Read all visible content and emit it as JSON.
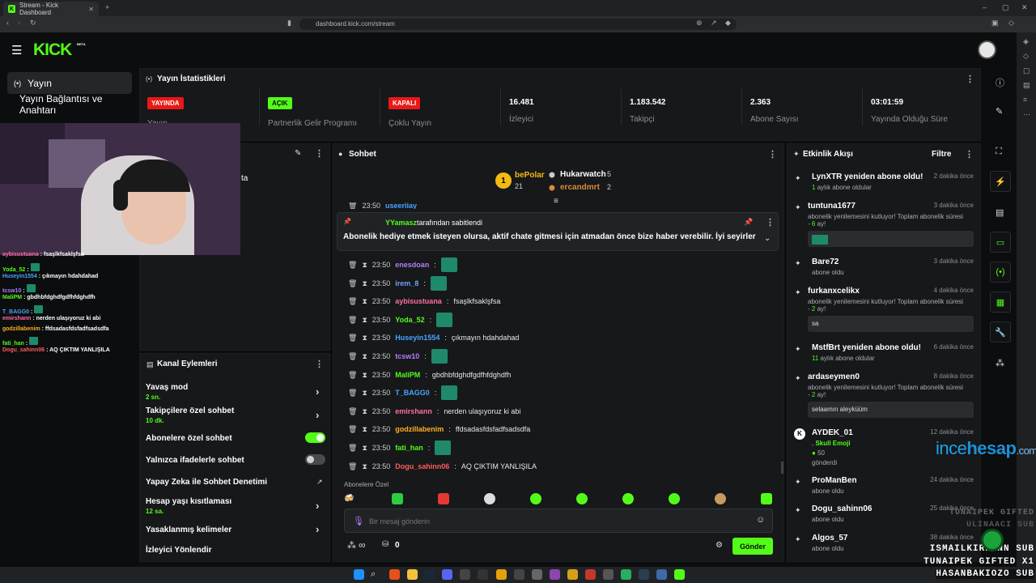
{
  "browser": {
    "tab_title": "Stream - Kick Dashboard",
    "url": "dashboard.kick.com/stream",
    "new_tab": "+",
    "win_min": "–",
    "win_max": "▢",
    "win_close": "✕"
  },
  "app": {
    "logo": "KICK",
    "beta": "BETA",
    "brand_color": "#53fc18"
  },
  "sidebar": {
    "items": [
      {
        "label": "Yayın",
        "icon": "broadcast-icon",
        "active": true
      },
      {
        "label": "Yayın Bağlantısı ve Anahtarı"
      }
    ]
  },
  "stats": {
    "title": "Yayın İstatistikleri",
    "items": [
      {
        "badge": "YAYINDA",
        "label": "Yayın",
        "badge_color": "#e91916"
      },
      {
        "badge": "AÇIK",
        "label": "Partnerlik Gelir Programı",
        "badge_color": "#53fc18"
      },
      {
        "badge": "KAPALI",
        "label": "Çoklu Yayın",
        "badge_color": "#e91916"
      },
      {
        "value": "16.481",
        "label": "İzleyici"
      },
      {
        "value": "1.183.542",
        "label": "Takipçi"
      },
      {
        "value": "2.363",
        "label": "Abone Sayısı"
      },
      {
        "value": "03:01:59",
        "label": "Yayında Olduğu Süre"
      }
    ]
  },
  "preview": {
    "partial_text": "ta"
  },
  "chat": {
    "title": "Sohbet",
    "leaders": [
      {
        "rank": "1",
        "name": "bePolar",
        "count": "21"
      },
      {
        "name": "Hukarwatch",
        "count": "5"
      },
      {
        "name": "ercandmrt",
        "count": "2"
      }
    ],
    "pinned": {
      "by_user": "YYamasz",
      "by_text": "tarafından sabitlendi",
      "message": "Abonelik hediye etmek isteyen olursa, aktif chate gitmesi için atmadan önce bize haber verebilir. İyi seyirler"
    },
    "partial_top": {
      "time": "23:50",
      "user": "useeriiay"
    },
    "messages": [
      {
        "time": "23:50",
        "user": "enesdoan",
        "text": "",
        "color": "#b57cff",
        "emote": true
      },
      {
        "time": "23:50",
        "user": "irem_8",
        "text": "",
        "color": "#7d9cff",
        "emote": true
      },
      {
        "time": "23:50",
        "user": "aybisustuana",
        "text": "fsaşlkfsaklşfsa",
        "color": "#ff6ea8",
        "emote": false
      },
      {
        "time": "23:50",
        "user": "Yoda_52",
        "text": "",
        "color": "#53fc18",
        "emote": true
      },
      {
        "time": "23:50",
        "user": "Huseyin1554",
        "text": "çıkmayın hdahdahad",
        "color": "#4aa3ff",
        "emote": false
      },
      {
        "time": "23:50",
        "user": "tcsw10",
        "text": "",
        "color": "#b57cff",
        "emote": true
      },
      {
        "time": "23:50",
        "user": "MaliPM",
        "text": "gbdhbfdghdfgdfhfdghdfh",
        "color": "#53fc18",
        "emote": false
      },
      {
        "time": "23:50",
        "user": "T_BAGG0",
        "text": "",
        "color": "#4aa3ff",
        "emote": true
      },
      {
        "time": "23:50",
        "user": "emirshann",
        "text": "nerden ulaşıyoruz ki abi",
        "color": "#ff6ea8",
        "emote": false
      },
      {
        "time": "23:50",
        "user": "godzillabenim",
        "text": "ffdsadasfdsfadfsadsdfa",
        "color": "#ffb020",
        "emote": false
      },
      {
        "time": "23:50",
        "user": "fati_han",
        "text": "",
        "color": "#53fc18",
        "emote": true
      },
      {
        "time": "23:50",
        "user": "Dogu_sahinn06",
        "text": "AQ ÇIKTIM YANLIŞILA",
        "color": "#ff5c5c",
        "emote": false
      }
    ],
    "subs_only_hint": "Abonelere Özel",
    "input_placeholder": "Bir mesaj gönderin",
    "points": "∞",
    "count": "0",
    "send_label": "Gönder"
  },
  "actions": {
    "title": "Kanal Eylemleri",
    "items": [
      {
        "label": "Yavaş mod",
        "sub": "2 sn.",
        "type": "chevron"
      },
      {
        "label": "Takipçilere özel sohbet",
        "sub": "10 dk.",
        "type": "chevron"
      },
      {
        "label": "Abonelere özel sohbet",
        "type": "toggle",
        "on": true
      },
      {
        "label": "Yalnızca ifadelerle sohbet",
        "type": "toggle",
        "on": false
      },
      {
        "label": "Yapay Zeka ile Sohbet Denetimi",
        "type": "external"
      },
      {
        "label": "Hesap yaşı kısıtlaması",
        "sub": "12 sa.",
        "type": "chevron"
      },
      {
        "label": "Yasaklanmış kelimeler",
        "type": "chevron"
      },
      {
        "label": "İzleyici Yönlendir",
        "type": "none"
      }
    ]
  },
  "activity": {
    "title": "Etkinlik Akışı",
    "filter": "Filtre",
    "events": [
      {
        "name": "LynXTR yeniden abone oldu!",
        "time": "2 dakika önce",
        "sub_num": "1",
        "sub": "aylık abone oldular"
      },
      {
        "name": "tuntuna1677",
        "time": "3 dakika önce",
        "sub": "abonelik yenilemesini kutluyor! Toplam abonelik süresi -",
        "sub_num": "6",
        "sub_tail": "ay!",
        "box": ""
      },
      {
        "name": "Bare72",
        "time": "3 dakika önce",
        "sub": "abone oldu"
      },
      {
        "name": "furkanxcelikx",
        "time": "4 dakika önce",
        "sub": "abonelik yenilemesini kutluyor! Toplam abonelik süresi -",
        "sub_num": "2",
        "sub_tail": "ay!",
        "box": "sa"
      },
      {
        "name": "MstfBrt yeniden abone oldu!",
        "time": "6 dakika önce",
        "sub_num": "11",
        "sub": "aylık abone oldular"
      },
      {
        "name": "ardaseymen0",
        "time": "8 dakika önce",
        "sub": "abonelik yenilemesini kutluyor! Toplam abonelik süresi -",
        "sub_num": "2",
        "sub_tail": "ay!",
        "box": "selaamın aleyküüm"
      },
      {
        "name": "AYDEK_01",
        "time": "12 dakika önce",
        "sub": ",",
        "item": "Skull Emoji",
        "amount": "50",
        "tail": "gönderdi"
      },
      {
        "name": "ProManBen",
        "time": "24 dakika önce",
        "sub": "abone oldu"
      },
      {
        "name": "Dogu_sahinn06",
        "time": "25 dakika önce",
        "sub": "abone oldu"
      },
      {
        "name": "Algos_57",
        "time": "38 dakika önce",
        "sub": "abone oldu"
      }
    ]
  },
  "overlay_chat": [
    {
      "user": "aybisustuana",
      "text": "fsaşlkfsaklşfsa",
      "color": "#ff6ea8"
    },
    {
      "user": "Yoda_52",
      "text": "",
      "color": "#53fc18"
    },
    {
      "user": "Huseyin1554",
      "text": "çıkmayın hdahdahad",
      "color": "#4aa3ff"
    },
    {
      "user": "tcsw10",
      "text": "",
      "color": "#b57cff"
    },
    {
      "user": "MaliPM",
      "text": "gbdhbfdghdfgdfhfdghdfh",
      "color": "#53fc18"
    },
    {
      "user": "T_BAGG0",
      "text": "",
      "color": "#4aa3ff"
    },
    {
      "user": "emirshann",
      "text": "nerden ulaşıyoruz ki abi",
      "color": "#ff6ea8"
    },
    {
      "user": "godzillabenim",
      "text": "ffdsadasfdsfadfsadsdfa",
      "color": "#ffb020"
    },
    {
      "user": "fati_han",
      "text": "",
      "color": "#53fc18"
    },
    {
      "user": "Dogu_sahinn06",
      "text": "AQ ÇIKTIM YANLIŞILA",
      "color": "#ff5c5c"
    }
  ],
  "watermark": {
    "a": "ince",
    "b": "hesap",
    "c": ".com"
  },
  "overlay_subs": [
    "TUNAIPEK GIFTED",
    "ULINAACI SUB",
    "ISMAILKIRKANN SUB",
    "TUNAIPEK GIFTED X1",
    "HASANBAKIOZO SUB"
  ]
}
